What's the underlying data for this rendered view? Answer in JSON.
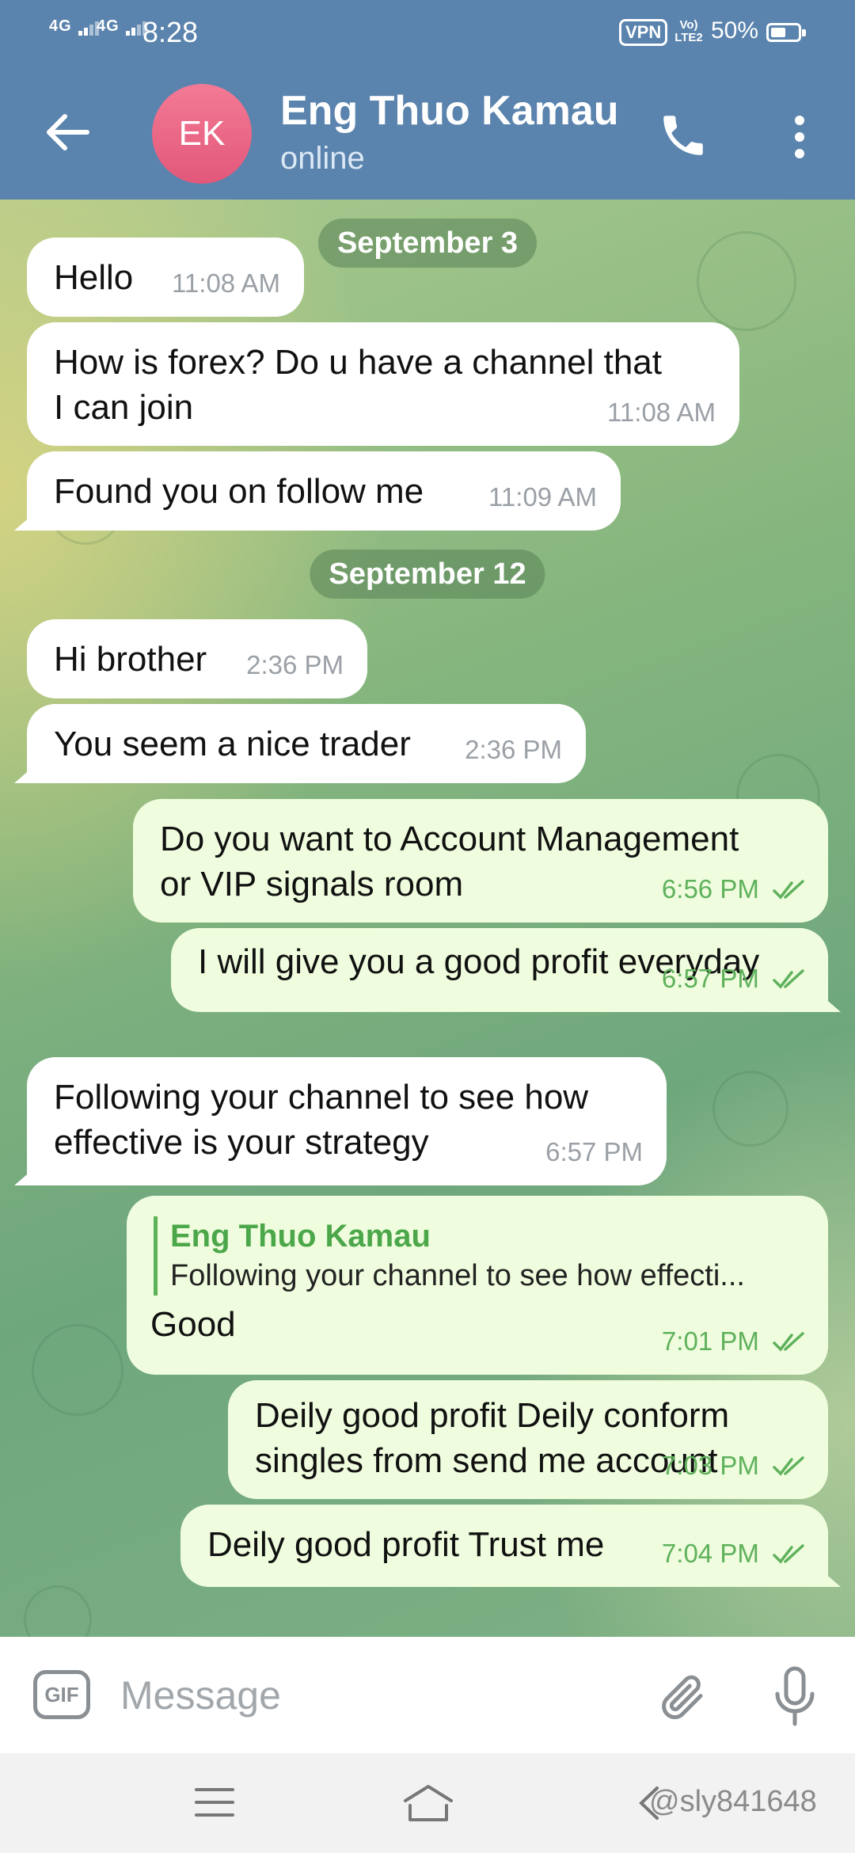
{
  "status_bar": {
    "network_1": "4G",
    "network_2": "4G",
    "time": "8:28",
    "vpn": "VPN",
    "volte": "Vo) LTE2",
    "battery": "50%"
  },
  "header": {
    "avatar_initials": "EK",
    "contact_name": "Eng Thuo Kamau",
    "status": "online"
  },
  "chat": {
    "dates": [
      "September 3",
      "September 12"
    ],
    "messages": [
      {
        "dir": "in",
        "lines": [
          "Hello"
        ],
        "time": "11:08 AM"
      },
      {
        "dir": "in",
        "lines": [
          "How is forex? Do u have a channel that",
          "I can join"
        ],
        "time": "11:08 AM"
      },
      {
        "dir": "in",
        "lines": [
          "Found you on follow me"
        ],
        "time": "11:09 AM"
      },
      {
        "dir": "in",
        "lines": [
          "Hi brother"
        ],
        "time": "2:36 PM"
      },
      {
        "dir": "in",
        "lines": [
          "You seem a nice trader"
        ],
        "time": "2:36 PM"
      },
      {
        "dir": "out",
        "lines": [
          "Do you want to Account Management",
          "or VIP signals room"
        ],
        "time": "6:56 PM"
      },
      {
        "dir": "out",
        "lines": [
          "I will give you a good profit everyday"
        ],
        "time": "6:57 PM"
      },
      {
        "dir": "in",
        "lines": [
          "Following your channel to see how",
          "effective is your strategy"
        ],
        "time": "6:57 PM"
      },
      {
        "dir": "out",
        "reply_name": "Eng Thuo Kamau",
        "reply_text": "Following your channel to see how effecti...",
        "lines": [
          "Good"
        ],
        "time": "7:01 PM"
      },
      {
        "dir": "out",
        "lines": [
          "Deily good  profit Deily conform",
          "singles from send me account"
        ],
        "time": "7:03 PM"
      },
      {
        "dir": "out",
        "lines": [
          "Deily good profit Trust me"
        ],
        "time": "7:04 PM"
      }
    ]
  },
  "input": {
    "gif_label": "GIF",
    "placeholder": "Message"
  },
  "watermark": "@sly841648",
  "icons": {
    "back": "arrow-left-icon",
    "call": "phone-icon",
    "more": "more-vertical-icon",
    "attach": "paperclip-icon",
    "mic": "microphone-icon",
    "read": "double-check-icon"
  },
  "colors": {
    "header": "#5a83ad",
    "incoming_bubble": "#ffffff",
    "outgoing_bubble": "#effdde",
    "outgoing_meta": "#5fb15c",
    "avatar": "#e96a89"
  }
}
